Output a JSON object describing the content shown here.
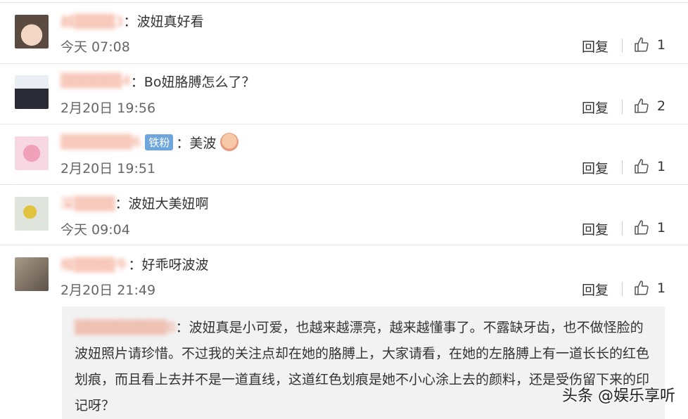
{
  "comments": [
    {
      "user": "越▒▒▒▒3",
      "colon": "：",
      "text": "波妞真好看",
      "time": "今天 07:08",
      "reply": "回复",
      "likes": "1"
    },
    {
      "user": "▒▒▒▒▒▒4",
      "colon": "：",
      "text": "Bo妞胳膊怎么了？",
      "time": "2月20日 19:56",
      "reply": "回复",
      "likes": "2"
    },
    {
      "user": "▒▒▒▒▒▒▒6",
      "badge": "铁粉",
      "colon": "：",
      "text": "美波",
      "time": "2月20日 19:51",
      "reply": "回复",
      "likes": "1"
    },
    {
      "user": "深▒▒▒▒",
      "colon": "：",
      "text": "波妞大美妞啊",
      "time": "今天 09:04",
      "reply": "回复",
      "likes": "1"
    },
    {
      "user": "帽▒▒▒▒牛",
      "colon": "：",
      "text": "好乖呀波波",
      "time": "2月20日 21:49",
      "reply": "回复",
      "likes": "1"
    }
  ],
  "quoted_reply": {
    "user": "▒▒▒▒▒▒▒▒▒0",
    "colon": "：",
    "text": "波妞真是小可爱，也越来越漂亮，越来越懂事了。不露缺牙齿，也不做怪脸的波妞照片请珍惜。不过我的关注点却在她的胳膊上，大家请看，在她的左胳膊上有一道长长的红色划痕，而且看上去并不是一道直线，这道红色划痕是她不小心涂上去的颜料，还是受伤留下来的印记呀？"
  },
  "watermark": "头条 @娱乐享听",
  "colors": {
    "username": "#eb7350",
    "badge": "#6ea6dc",
    "quote_bg": "#f2f2f2"
  },
  "icons": {
    "like": "thumbs-up-icon",
    "emoji": "face-emoji-icon"
  }
}
